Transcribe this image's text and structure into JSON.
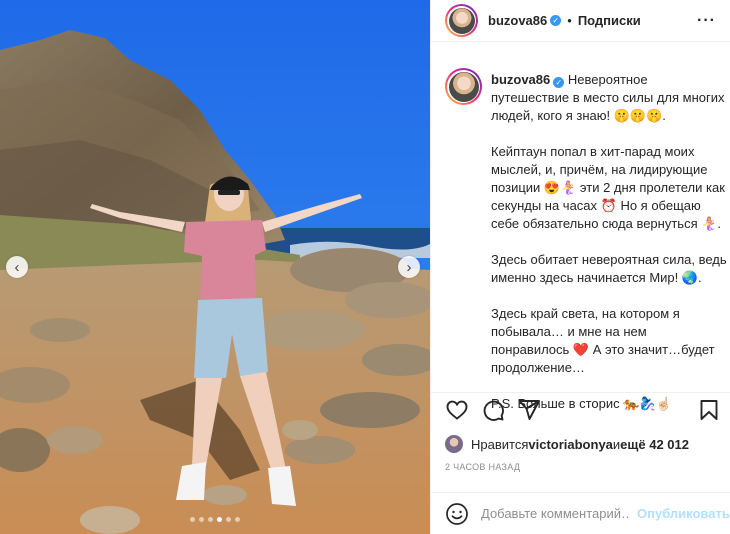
{
  "header": {
    "username": "buzova86",
    "separator": "•",
    "follow_label": "Подписки",
    "more_label": "···"
  },
  "caption": {
    "username": "buzova86",
    "paragraphs": [
      "Невероятное путешествие в место силы для многих людей, кого я знаю! 🤫🤫🤫.",
      "Кейптаун попал в хит-парад моих мыслей, и, причём, на лидирующие позиции 😍🧜‍♀️ эти 2 дня пролетели как секунды на часах ⏰ Но я обещаю себе обязательно сюда вернуться 🧜‍♀️.",
      "Здесь обитает невероятная сила, ведь именно здесь начинается Мир! 🌏.",
      "Здесь край света, на котором я побывала… и мне на нем понравилось ❤️ А это значит…будет продолжение…",
      "P.S. Больше в сторис 🐅🧞‍♀️☝🏻"
    ]
  },
  "likes": {
    "prefix": "Нравится ",
    "user": "victoriabonya",
    "middle": " и ",
    "count": "ещё 42 012"
  },
  "time_label": "2 часов назад",
  "comment": {
    "placeholder": "Добавьте комментарий…",
    "publish_label": "Опубликовать"
  },
  "carousel": {
    "prev_icon": "chevron-left-icon",
    "next_icon": "chevron-right-icon",
    "slide_count": 6,
    "active_slide": 4
  },
  "colors": {
    "verified": "#3897f0",
    "publish_disabled": "#b2dffc",
    "heart": "#ed4956"
  }
}
